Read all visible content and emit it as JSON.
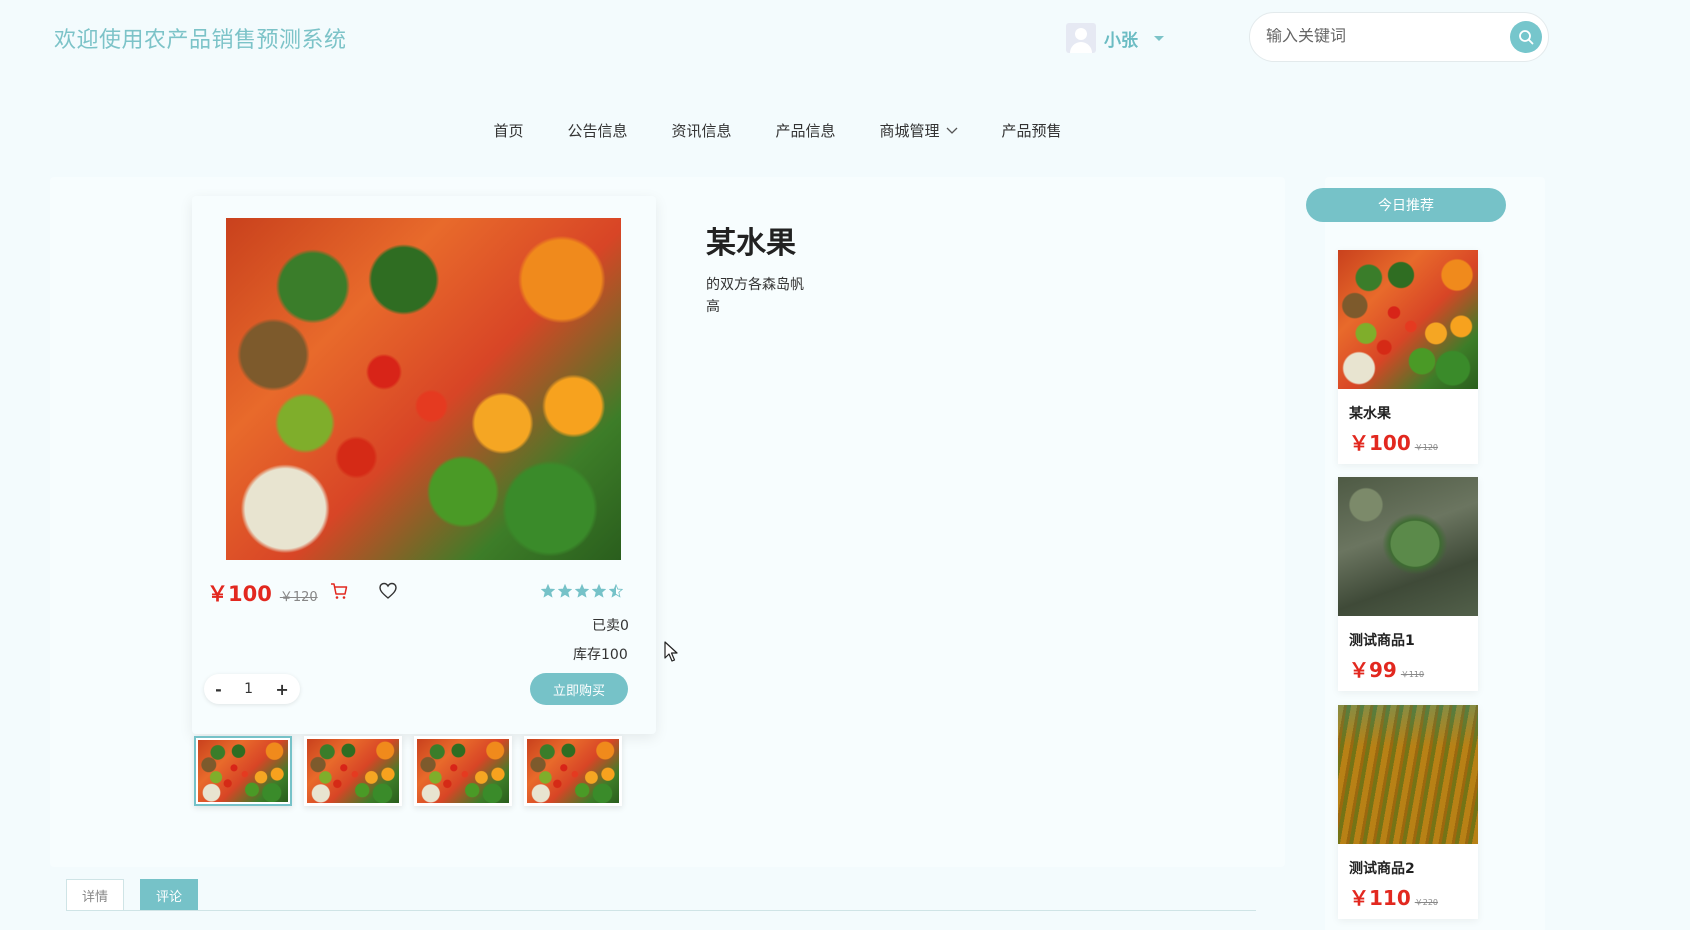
{
  "header": {
    "site_title": "欢迎使用农产品销售预测系统",
    "user_name": "小张",
    "search_placeholder": "输入关键词"
  },
  "nav": {
    "items": [
      {
        "label": "首页"
      },
      {
        "label": "公告信息"
      },
      {
        "label": "资讯信息"
      },
      {
        "label": "产品信息"
      },
      {
        "label": "商城管理",
        "has_dropdown": true
      },
      {
        "label": "产品预售"
      }
    ]
  },
  "product": {
    "title": "某水果",
    "description": "的双方各森岛帆高",
    "price": "￥100",
    "old_price": "￥120",
    "rating": 4.5,
    "rating_max": 5,
    "sold": "已卖0",
    "stock": "库存100",
    "quantity": "1",
    "qty_minus": "-",
    "qty_plus": "+",
    "buy_label": "立即购买",
    "thumbnails_count": 4
  },
  "tabs": [
    {
      "label": "详情",
      "active": false
    },
    {
      "label": "评论",
      "active": true
    }
  ],
  "recommend": {
    "title": "今日推荐",
    "items": [
      {
        "name": "某水果",
        "price": "￥100",
        "old_price": "￥120"
      },
      {
        "name": "测试商品1",
        "price": "￥99",
        "old_price": "￥110"
      },
      {
        "name": "测试商品2",
        "price": "￥110",
        "old_price": "￥220"
      }
    ]
  },
  "colors": {
    "accent": "#76c2c8",
    "price": "#e2281f",
    "background": "#f3fbfd"
  }
}
